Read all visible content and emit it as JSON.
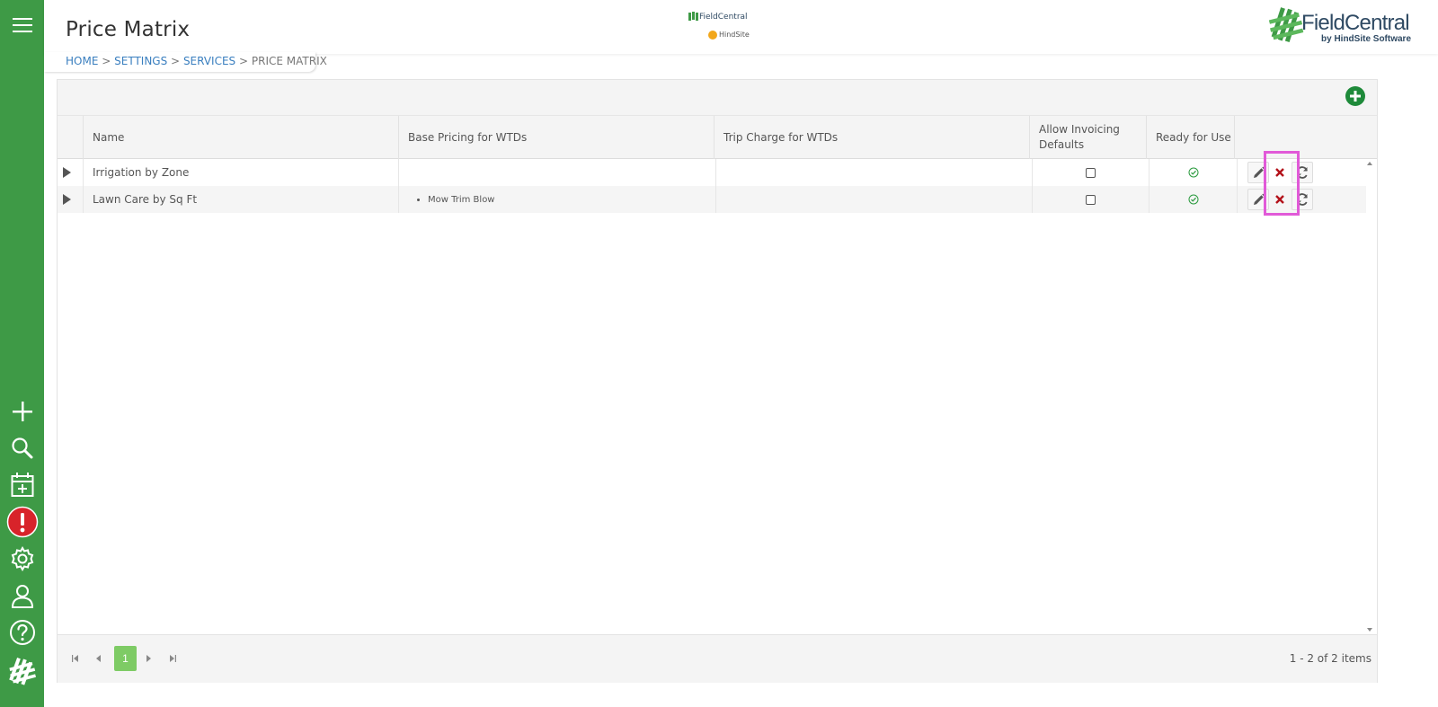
{
  "header": {
    "page_title": "Price Matrix",
    "brand_name": "FieldCentral",
    "brand_sub": "by HindSite Software",
    "center_logo_line1": "FieldCentral",
    "center_logo_line2": "HindSite"
  },
  "breadcrumb": {
    "home": "HOME",
    "settings": "SETTINGS",
    "services": "SERVICES",
    "current": "PRICE MATRIX",
    "separator": ">"
  },
  "sidebar": {
    "items": [
      {
        "icon": "plus-icon"
      },
      {
        "icon": "search-icon"
      },
      {
        "icon": "calendar-add-icon"
      },
      {
        "icon": "alert-icon"
      },
      {
        "icon": "gear-icon"
      },
      {
        "icon": "user-icon"
      },
      {
        "icon": "help-icon"
      },
      {
        "icon": "fieldcentral-logo-icon"
      }
    ]
  },
  "table": {
    "columns": [
      {
        "label": "Name"
      },
      {
        "label": "Base Pricing for WTDs"
      },
      {
        "label": "Trip Charge for WTDs"
      },
      {
        "label": "Allow Invoicing Defaults"
      },
      {
        "label": "Ready for Use"
      }
    ],
    "rows": [
      {
        "name": "Irrigation by Zone",
        "base_pricing": [],
        "trip_charge": "",
        "allow_invoicing": false,
        "ready": true
      },
      {
        "name": "Lawn Care by Sq Ft",
        "base_pricing": [
          "Mow Trim Blow"
        ],
        "trip_charge": "",
        "allow_invoicing": false,
        "ready": true
      }
    ]
  },
  "pager": {
    "current_page": "1",
    "info": "1 - 2 of 2 items"
  },
  "colors": {
    "sidebar": "#3e9a46",
    "add_button": "#1e8a3a",
    "active_page": "#7ecb65",
    "highlight": "#e15ad8",
    "delete": "#b3121a",
    "alert": "#d8232a"
  }
}
